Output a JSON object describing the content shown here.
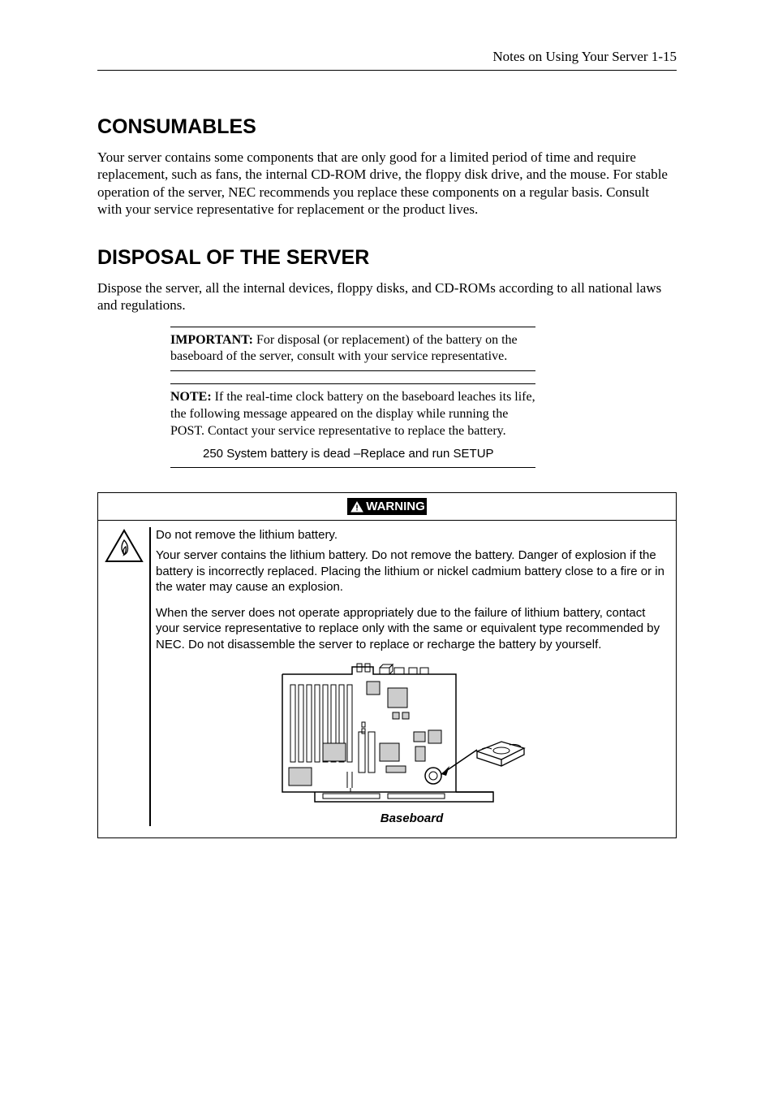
{
  "header": {
    "running": "Notes on Using Your Server   1-15"
  },
  "sections": {
    "consumables": {
      "title": "CONSUMABLES",
      "body": "Your server contains some components that are only good for a limited period of time and require replacement, such as fans, the internal CD-ROM drive, the floppy disk drive, and the mouse.    For stable operation of the server, NEC recommends you replace these components on a regular basis.  Consult with your service representative for replacement or the product lives."
    },
    "disposal": {
      "title": "DISPOSAL OF THE SERVER",
      "body": "Dispose the server, all the internal devices, floppy disks, and CD-ROMs according to all national laws and regulations.",
      "important": {
        "label": "IMPORTANT:",
        "text": " For disposal (or replacement) of the battery on the baseboard of the server, consult with your service representative."
      },
      "note": {
        "label": "NOTE:",
        "text": " If the real-time clock battery on the baseboard leaches its life, the following message appeared on the display while running the POST.  Contact your service representative to replace the battery.",
        "msg": "250 System battery is dead –Replace and run SETUP"
      }
    }
  },
  "warning": {
    "label": "WARNING",
    "p1": "Do not remove the lithium battery.",
    "p2": "Your server contains the lithium battery.    Do not remove the battery. Danger of explosion if the battery is incorrectly replaced. Placing the lithium or nickel cadmium battery close to a fire or in the water may cause an explosion.",
    "p3": "When the server does not operate appropriately due to the failure of lithium battery, contact your service representative to replace only with the same or equivalent type recommended by NEC. Do not disassemble the server to replace or recharge the battery by yourself.",
    "caption": "Baseboard"
  }
}
